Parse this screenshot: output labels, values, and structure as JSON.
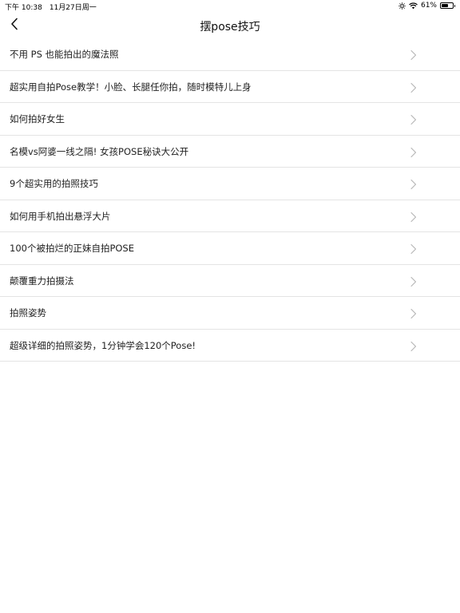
{
  "status_bar": {
    "time": "下午 10:38",
    "date": "11月27日周一",
    "battery_text": "61%",
    "battery_level": 0.61,
    "icons": [
      "brightness-icon",
      "wifi-icon",
      "battery-icon"
    ]
  },
  "nav": {
    "title": "摆pose技巧",
    "back_icon": "chevron-left-icon"
  },
  "list": {
    "items": [
      {
        "label": "不用 PS 也能拍出的魔法照"
      },
      {
        "label": "超实用自拍Pose教学！小脸、长腿任你拍，随时模特儿上身"
      },
      {
        "label": "如何拍好女生"
      },
      {
        "label": "名模vs阿婆一线之隔! 女孩POSE秘诀大公开"
      },
      {
        "label": "9个超实用的拍照技巧"
      },
      {
        "label": "如何用手机拍出悬浮大片"
      },
      {
        "label": "100个被拍烂的正妹自拍POSE"
      },
      {
        "label": "颠覆重力拍摄法"
      },
      {
        "label": "拍照姿势"
      },
      {
        "label": "超级详细的拍照姿势，1分钟学会120个Pose!"
      }
    ],
    "item_icon": "chevron-right-icon"
  },
  "colors": {
    "background": "#ffffff",
    "divider": "#e4e4e4",
    "chevron": "#b5b5b5",
    "text": "#222222"
  }
}
